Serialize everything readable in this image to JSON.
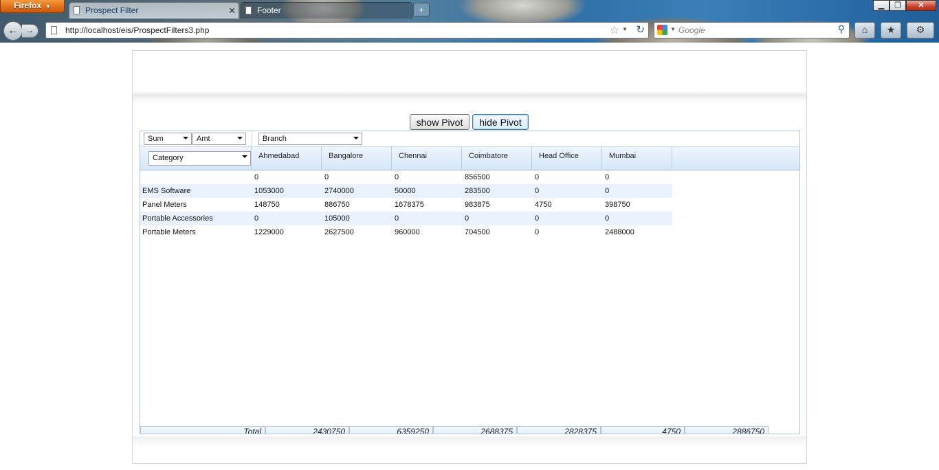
{
  "browser": {
    "app_button": "Firefox",
    "tabs": [
      {
        "label": "Prospect Filter",
        "active": true
      },
      {
        "label": "Footer",
        "active": false
      }
    ],
    "new_tab": "+",
    "url": "http://localhost/eis/ProspectFilters3.php",
    "search_placeholder": "Google"
  },
  "page": {
    "buttons": {
      "show": "show Pivot",
      "hide": "hide Pivot"
    },
    "pivot": {
      "aggregate": "Sum",
      "measure": "Amt",
      "column_field": "Branch",
      "row_field": "Category",
      "columns": [
        "Ahmedabad",
        "Bangalore",
        "Chennai",
        "Coimbatore",
        "Head Office",
        "Mumbai"
      ],
      "rows": [
        {
          "label": "",
          "values": [
            "0",
            "0",
            "0",
            "856500",
            "0",
            "0"
          ]
        },
        {
          "label": "EMS Software",
          "values": [
            "1053000",
            "2740000",
            "50000",
            "283500",
            "0",
            "0"
          ]
        },
        {
          "label": "Panel Meters",
          "values": [
            "148750",
            "886750",
            "1678375",
            "983875",
            "4750",
            "398750"
          ]
        },
        {
          "label": "Portable Accessories",
          "values": [
            "0",
            "105000",
            "0",
            "0",
            "0",
            "0"
          ]
        },
        {
          "label": "Portable Meters",
          "values": [
            "1229000",
            "2627500",
            "960000",
            "704500",
            "0",
            "2488000"
          ]
        }
      ],
      "total_label": "Total",
      "totals": [
        "2430750",
        "6359250",
        "2688375",
        "2828375",
        "4750",
        "2886750"
      ]
    }
  }
}
